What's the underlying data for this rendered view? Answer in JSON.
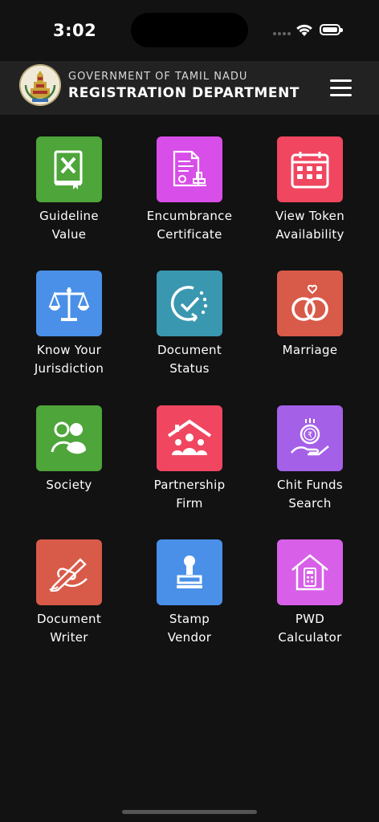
{
  "status_bar": {
    "time": "3:02"
  },
  "header": {
    "subtitle": "GOVERNMENT OF TAMIL NADU",
    "title": "REGISTRATION DEPARTMENT"
  },
  "tiles": [
    {
      "lines": [
        "Guideline",
        "Value"
      ],
      "icon": "guideline-book-icon",
      "color": "#4ea53a"
    },
    {
      "lines": [
        "Encumbrance",
        "Certificate"
      ],
      "icon": "certificate-stamp-icon",
      "color": "#d84ee8"
    },
    {
      "lines": [
        "View Token",
        "Availability"
      ],
      "icon": "calendar-check-icon",
      "color": "#f04660"
    },
    {
      "lines": [
        "Know Your",
        "Jurisdiction"
      ],
      "icon": "scales-of-justice-icon",
      "color": "#4a90e8"
    },
    {
      "lines": [
        "Document",
        "Status"
      ],
      "icon": "status-check-icon",
      "color": "#3a97b0"
    },
    {
      "lines": [
        "Marriage"
      ],
      "icon": "wedding-rings-icon",
      "color": "#d85a48"
    },
    {
      "lines": [
        "Society"
      ],
      "icon": "people-group-icon",
      "color": "#4ea53a"
    },
    {
      "lines": [
        "Partnership",
        "Firm"
      ],
      "icon": "house-family-icon",
      "color": "#f04660"
    },
    {
      "lines": [
        "Chit Funds",
        "Search"
      ],
      "icon": "rupee-coin-hand-icon",
      "color": "#a560e8"
    },
    {
      "lines": [
        "Document",
        "Writer"
      ],
      "icon": "writing-hand-icon",
      "color": "#d85a48"
    },
    {
      "lines": [
        "Stamp",
        "Vendor"
      ],
      "icon": "rubber-stamp-icon",
      "color": "#4a90e8"
    },
    {
      "lines": [
        "PWD",
        "Calculator"
      ],
      "icon": "house-calculator-icon",
      "color": "#d860e8"
    }
  ]
}
